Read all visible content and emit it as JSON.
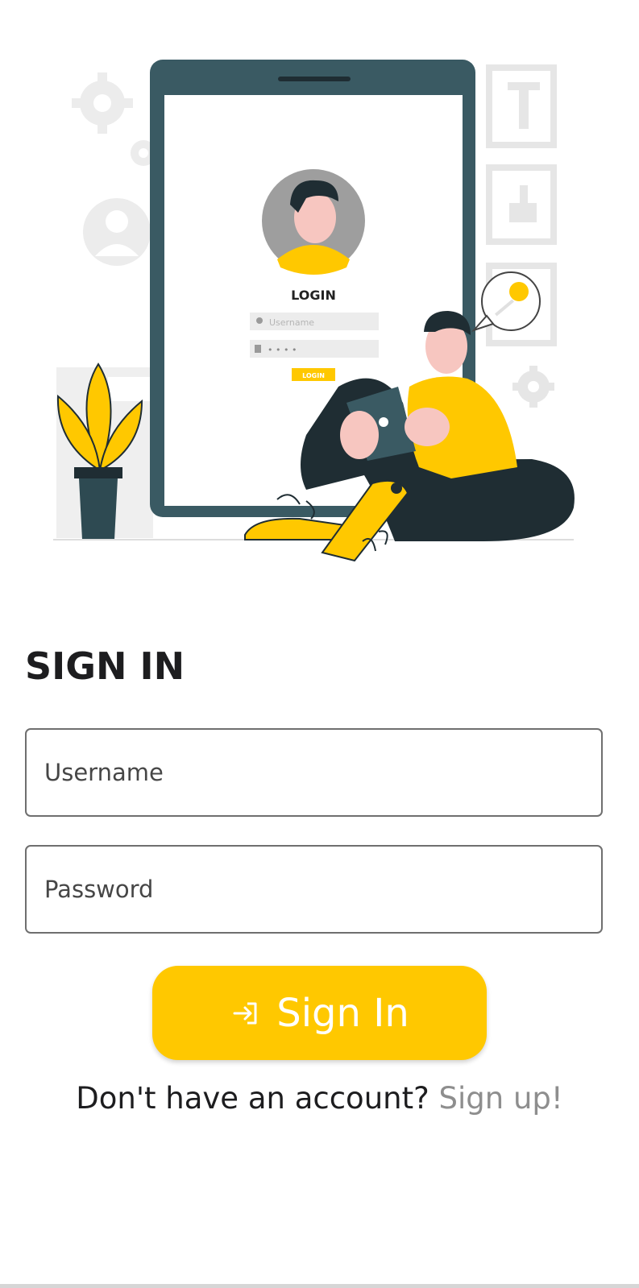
{
  "illustration": {
    "login_label": "LOGIN",
    "username_hint": "Username",
    "password_hint": "• • • •",
    "button_label": "LOGIN"
  },
  "form": {
    "title": "SIGN IN",
    "username_placeholder": "Username",
    "password_placeholder": "Password",
    "submit_label": "Sign In"
  },
  "footer": {
    "prompt": "Don't have an account?",
    "link_label": "Sign up!"
  },
  "colors": {
    "accent": "#ffc800",
    "tablet_frame": "#3a5a63",
    "dark": "#1f2d33"
  },
  "icons": {
    "submit_icon": "login-arrow-icon"
  }
}
